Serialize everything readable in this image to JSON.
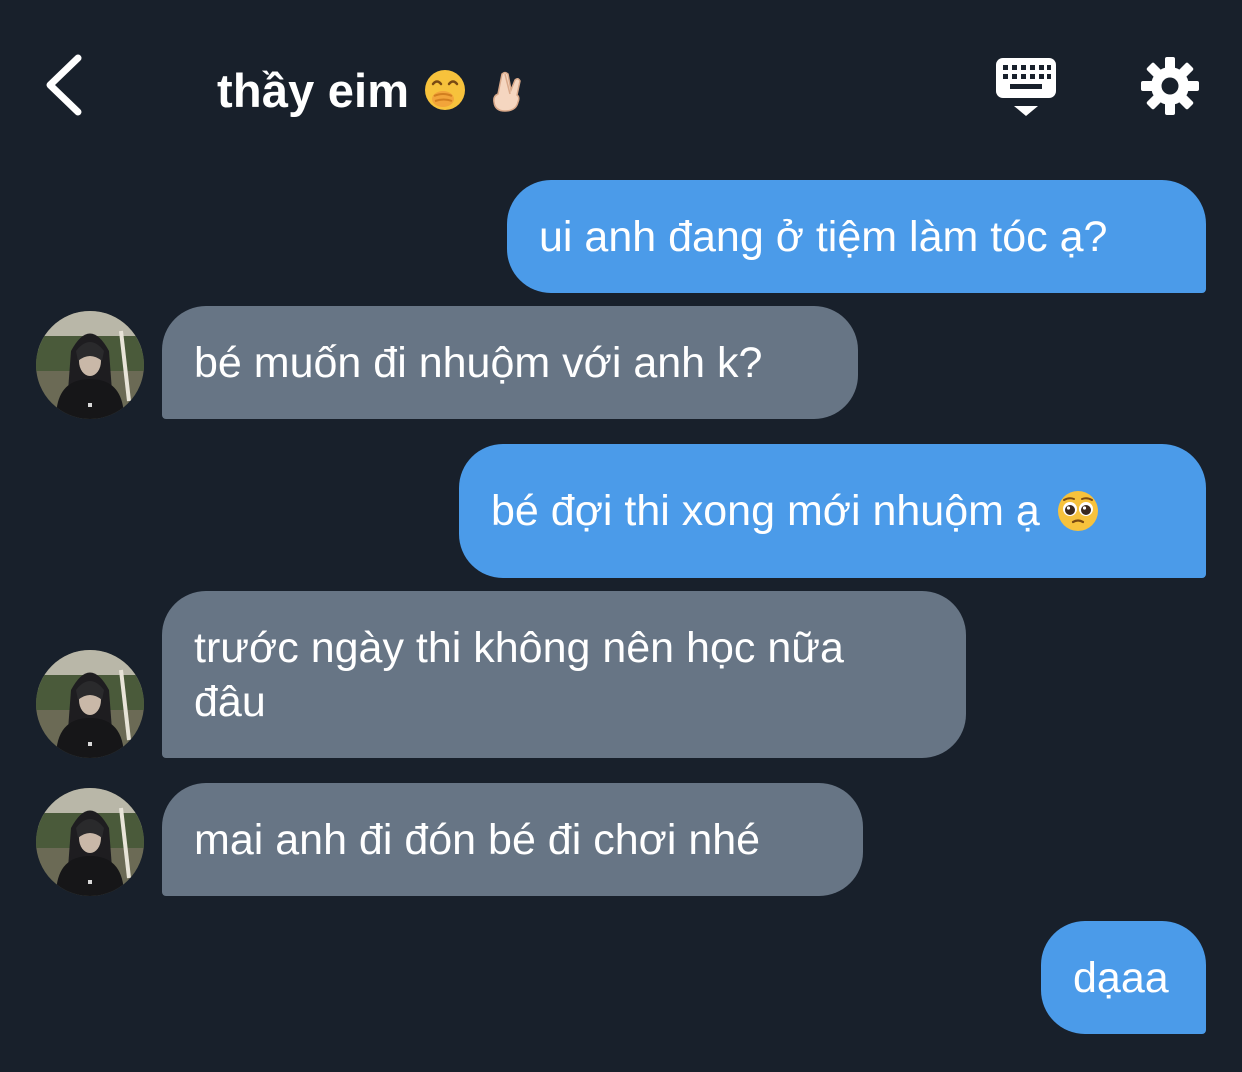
{
  "header": {
    "title": "thầy eim",
    "title_emojis": [
      "face-with-hand-over-mouth-emoji",
      "crossed-fingers-emoji"
    ],
    "icons": {
      "back": "chevron-left-icon",
      "keyboard": "keyboard-icon",
      "settings": "gear-icon"
    }
  },
  "colors": {
    "background": "#18202b",
    "outgoing_bubble": "#4b9be9",
    "incoming_bubble": "#677585",
    "text": "#ffffff"
  },
  "messages": [
    {
      "direction": "out",
      "text": "ui anh đang ở tiệm làm tóc ạ?"
    },
    {
      "direction": "in",
      "text": "bé muốn đi nhuộm với anh k?"
    },
    {
      "direction": "out",
      "text": "bé đợi thi xong mới nhuộm ạ",
      "emoji": "pleading-face-emoji"
    },
    {
      "direction": "in",
      "text_line1": "trước ngày thi không nên học nữa",
      "text_line2": "đâu"
    },
    {
      "direction": "in",
      "text": "mai anh đi đón bé đi chơi nhé"
    },
    {
      "direction": "out",
      "text": "dạaa"
    }
  ]
}
